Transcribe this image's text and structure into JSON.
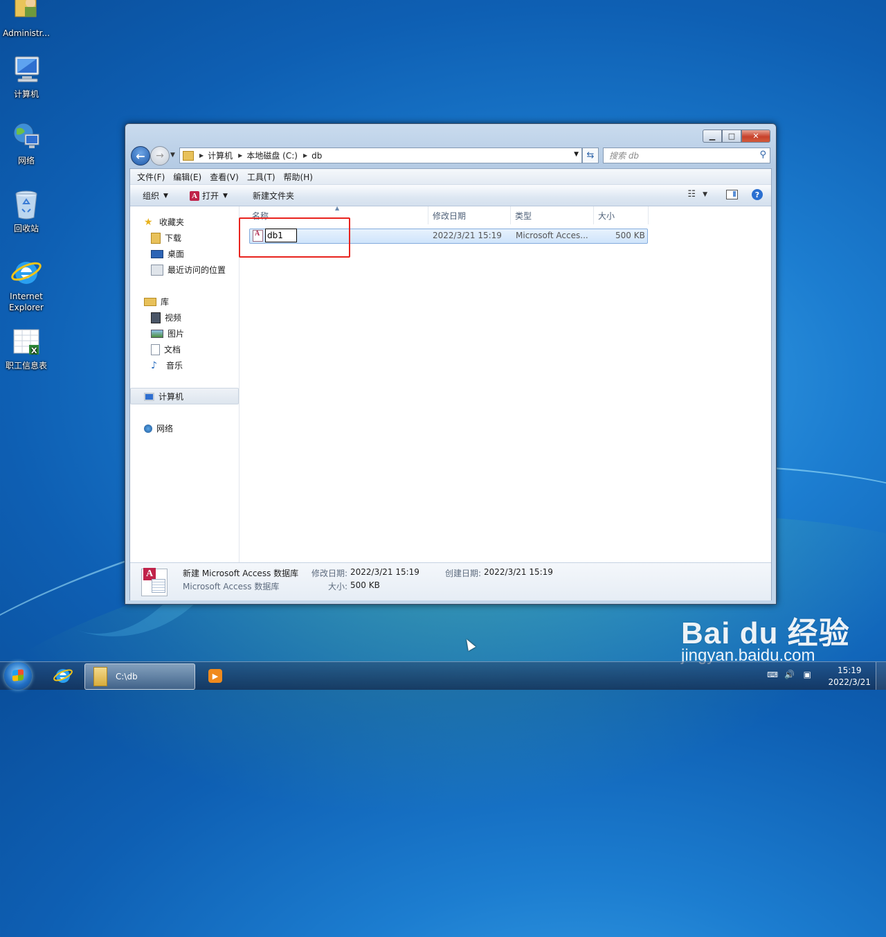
{
  "desktop": {
    "icons": [
      {
        "label": "Administr...",
        "icon": "user-folder-icon"
      },
      {
        "label": "计算机",
        "icon": "computer-icon"
      },
      {
        "label": "网络",
        "icon": "network-icon"
      },
      {
        "label": "回收站",
        "icon": "recycle-bin-icon"
      },
      {
        "label": "Internet\nExplorer",
        "icon": "internet-explorer-icon"
      },
      {
        "label": "职工信息表",
        "icon": "excel-file-icon"
      }
    ]
  },
  "window": {
    "caption_buttons": {
      "minimize": "▁",
      "maximize": "□",
      "close": "✕"
    },
    "address": {
      "breadcrumb": [
        "计算机",
        "本地磁盘 (C:)",
        "db"
      ]
    },
    "search": {
      "placeholder": "搜索 db"
    },
    "menu": [
      "文件(F)",
      "编辑(E)",
      "查看(V)",
      "工具(T)",
      "帮助(H)"
    ],
    "toolbar": {
      "organize": "组织",
      "open": "打开",
      "new_folder": "新建文件夹"
    },
    "nav_pane": {
      "favorites": {
        "label": "收藏夹",
        "items": [
          "下载",
          "桌面",
          "最近访问的位置"
        ]
      },
      "libraries": {
        "label": "库",
        "items": [
          "视频",
          "图片",
          "文档",
          "音乐"
        ]
      },
      "computer": "计算机",
      "network": "网络"
    },
    "columns": [
      "名称",
      "修改日期",
      "类型",
      "大小"
    ],
    "files": [
      {
        "name": "db1",
        "modified": "2022/3/21 15:19",
        "type": "Microsoft Acces...",
        "size": "500 KB",
        "renaming": true
      }
    ],
    "details": {
      "title": "新建 Microsoft Access 数据库",
      "type": "Microsoft Access 数据库",
      "modified_label": "修改日期:",
      "modified_value": "2022/3/21 15:19",
      "size_label": "大小:",
      "size_value": "500 KB",
      "created_label": "创建日期:",
      "created_value": "2022/3/21 15:19"
    }
  },
  "taskbar": {
    "explorer_button": "C:\\db",
    "time": "15:19",
    "date": "2022/3/21"
  },
  "watermark": {
    "brand": "Bai du 经验",
    "url": "jingyan.baidu.com"
  },
  "colors": {
    "highlight_box": "#e8231e",
    "selection": "#cfe4fb",
    "access_red": "#c0234a"
  }
}
